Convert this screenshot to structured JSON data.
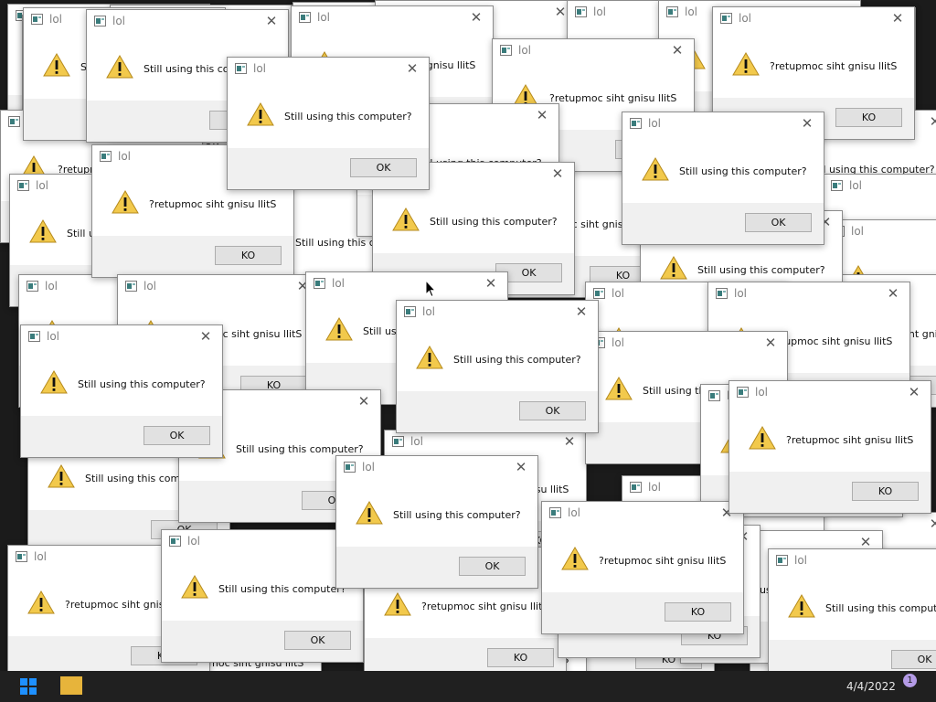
{
  "dialog": {
    "title": "lol",
    "message": "Still using this computer?",
    "message_reversed": "?retupmoc siht gnisu llitS",
    "ok_label": "OK",
    "ok_label_reversed": "KO",
    "icon": "warning-icon",
    "close_icon": "close-icon"
  },
  "taskbar": {
    "date": "4/4/2022",
    "notification_count": "1",
    "start_icon": "windows-start-icon",
    "pinned_icon": "file-explorer-icon"
  },
  "colors": {
    "dialog_bg": "#ffffff",
    "footer_bg": "#f0f0f0",
    "button_bg": "#e1e1e1",
    "warning": "#f2c94c",
    "taskbar": "#202020",
    "start_blue": "#1e90ff"
  }
}
